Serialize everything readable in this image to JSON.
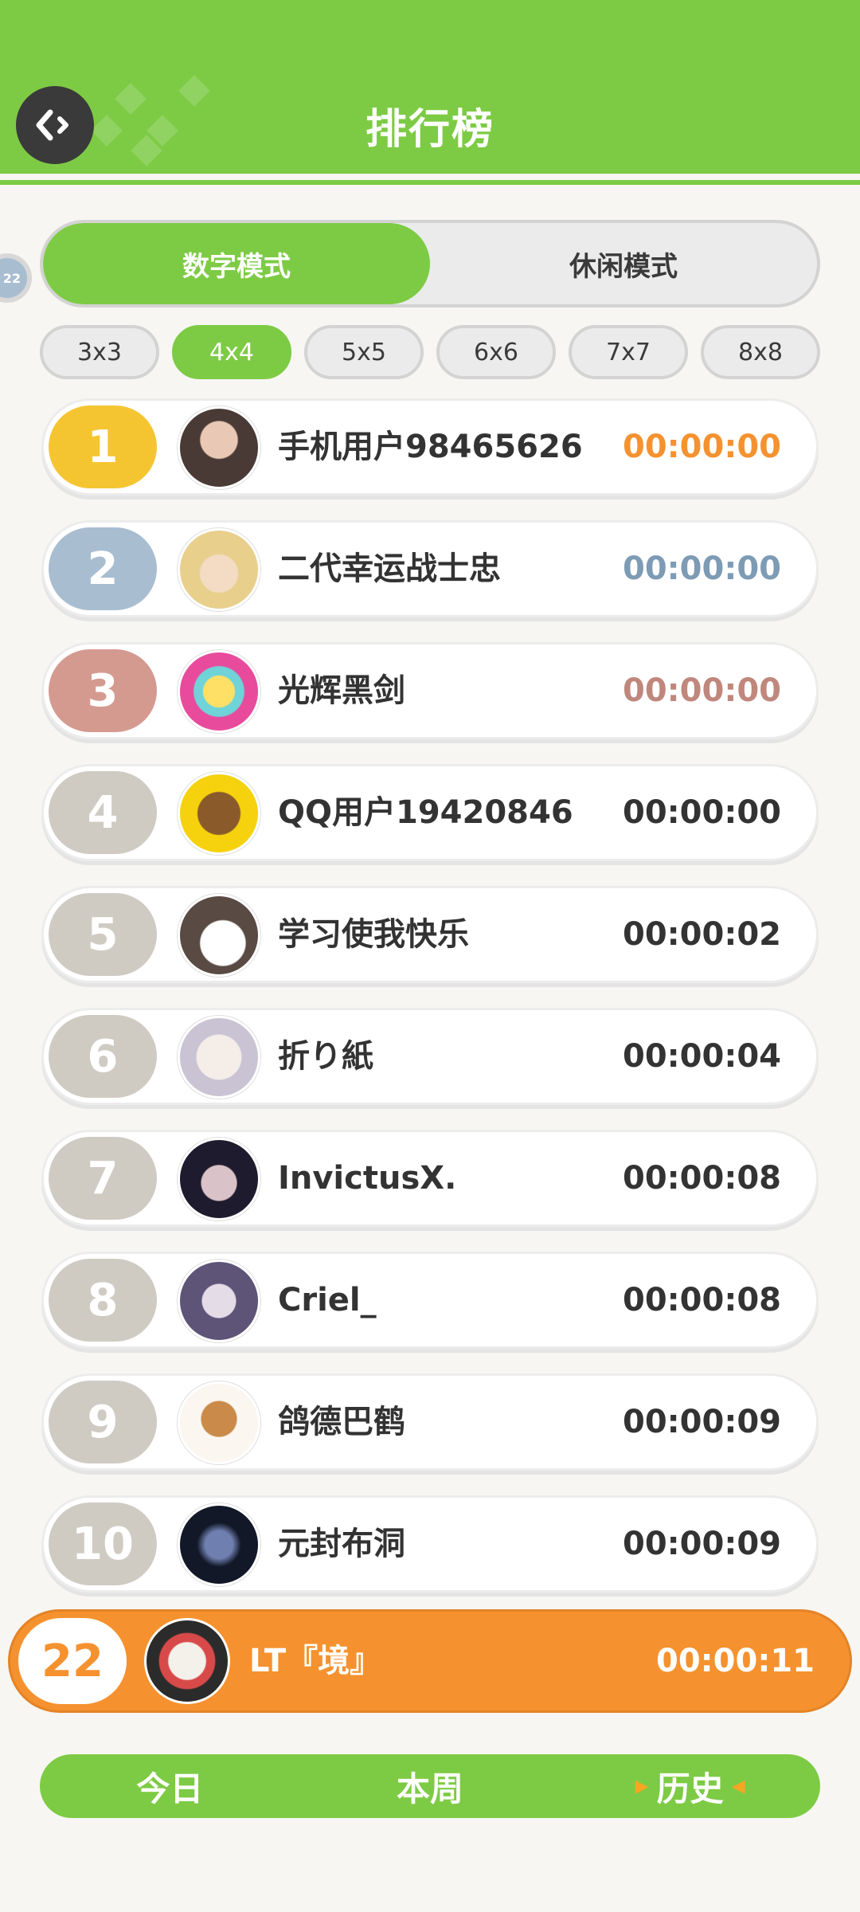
{
  "header": {
    "title": "排行榜"
  },
  "side_badge": "22",
  "modes": [
    {
      "label": "数字模式",
      "active": true
    },
    {
      "label": "休闲模式",
      "active": false
    }
  ],
  "sizes": [
    {
      "label": "3x3",
      "active": false
    },
    {
      "label": "4x4",
      "active": true
    },
    {
      "label": "5x5",
      "active": false
    },
    {
      "label": "6x6",
      "active": false
    },
    {
      "label": "7x7",
      "active": false
    },
    {
      "label": "8x8",
      "active": false
    }
  ],
  "leaderboard": [
    {
      "rank": "1",
      "name": "手机用户98465626",
      "time": "00:00:00",
      "rank_color": "#f5c531",
      "time_color": "#f5922f"
    },
    {
      "rank": "2",
      "name": "二代幸运战士忠",
      "time": "00:00:00",
      "rank_color": "#a9bdd0",
      "time_color": "#7d9bb5"
    },
    {
      "rank": "3",
      "name": "光辉黑剑",
      "time": "00:00:00",
      "rank_color": "#d49a90",
      "time_color": "#c0877c"
    },
    {
      "rank": "4",
      "name": "QQ用户19420846",
      "time": "00:00:00",
      "rank_color": "#cfcbc3",
      "time_color": "#333333"
    },
    {
      "rank": "5",
      "name": "学习使我快乐",
      "time": "00:00:02",
      "rank_color": "#cfcbc3",
      "time_color": "#333333"
    },
    {
      "rank": "6",
      "name": "折り紙",
      "time": "00:00:04",
      "rank_color": "#cfcbc3",
      "time_color": "#333333"
    },
    {
      "rank": "7",
      "name": "InvictusX.",
      "time": "00:00:08",
      "rank_color": "#cfcbc3",
      "time_color": "#333333"
    },
    {
      "rank": "8",
      "name": "Criel_",
      "time": "00:00:08",
      "rank_color": "#cfcbc3",
      "time_color": "#333333"
    },
    {
      "rank": "9",
      "name": "鸽德巴鹤",
      "time": "00:00:09",
      "rank_color": "#cfcbc3",
      "time_color": "#333333"
    },
    {
      "rank": "10",
      "name": "元封布洞",
      "time": "00:00:09",
      "rank_color": "#cfcbc3",
      "time_color": "#333333"
    }
  ],
  "me": {
    "rank": "22",
    "name": "LT『境』",
    "time": "00:00:11"
  },
  "periods": [
    {
      "label": "今日",
      "active": false
    },
    {
      "label": "本周",
      "active": false
    },
    {
      "label": "历史",
      "active": true
    }
  ]
}
